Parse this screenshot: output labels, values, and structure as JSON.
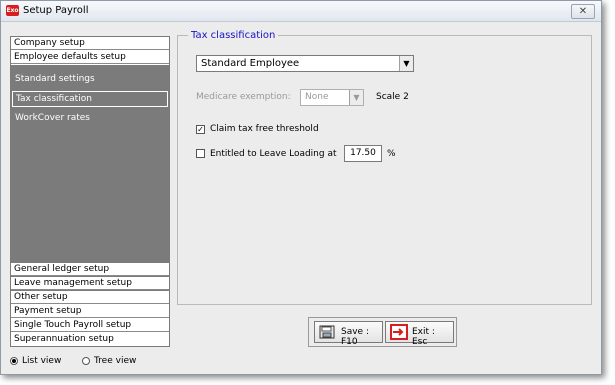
{
  "window": {
    "title": "Setup Payroll",
    "app_icon_text": "Exo",
    "close_symbol": "✕"
  },
  "nav": {
    "top_headers": [
      "Company setup",
      "Employee defaults setup"
    ],
    "sub_items": [
      "Standard settings",
      "Tax classification",
      "WorkCover rates"
    ],
    "selected_sub": "Tax classification",
    "bottom_headers": [
      "General ledger setup",
      "Leave management setup",
      "Other setup",
      "Payment setup",
      "Single Touch Payroll setup",
      "Superannuation setup"
    ]
  },
  "tax": {
    "group_label": "Tax classification",
    "classification_value": "Standard Employee",
    "medicare_label": "Medicare exemption:",
    "medicare_value": "None",
    "scale_label": "Scale 2",
    "claim_label": "Claim tax free threshold",
    "claim_checked": true,
    "leave_label": "Entitled to Leave Loading at",
    "leave_checked": false,
    "leave_value": "17.50",
    "leave_unit": "%"
  },
  "buttons": {
    "save_label": "Save : F10",
    "exit_label": "Exit : Esc"
  },
  "view": {
    "list_label": "List view",
    "tree_label": "Tree view",
    "selected": "List view"
  },
  "colors": {
    "nav_panel": "#7b7b7b",
    "group_label": "#1414c8",
    "exit_icon": "#d71e1e"
  }
}
